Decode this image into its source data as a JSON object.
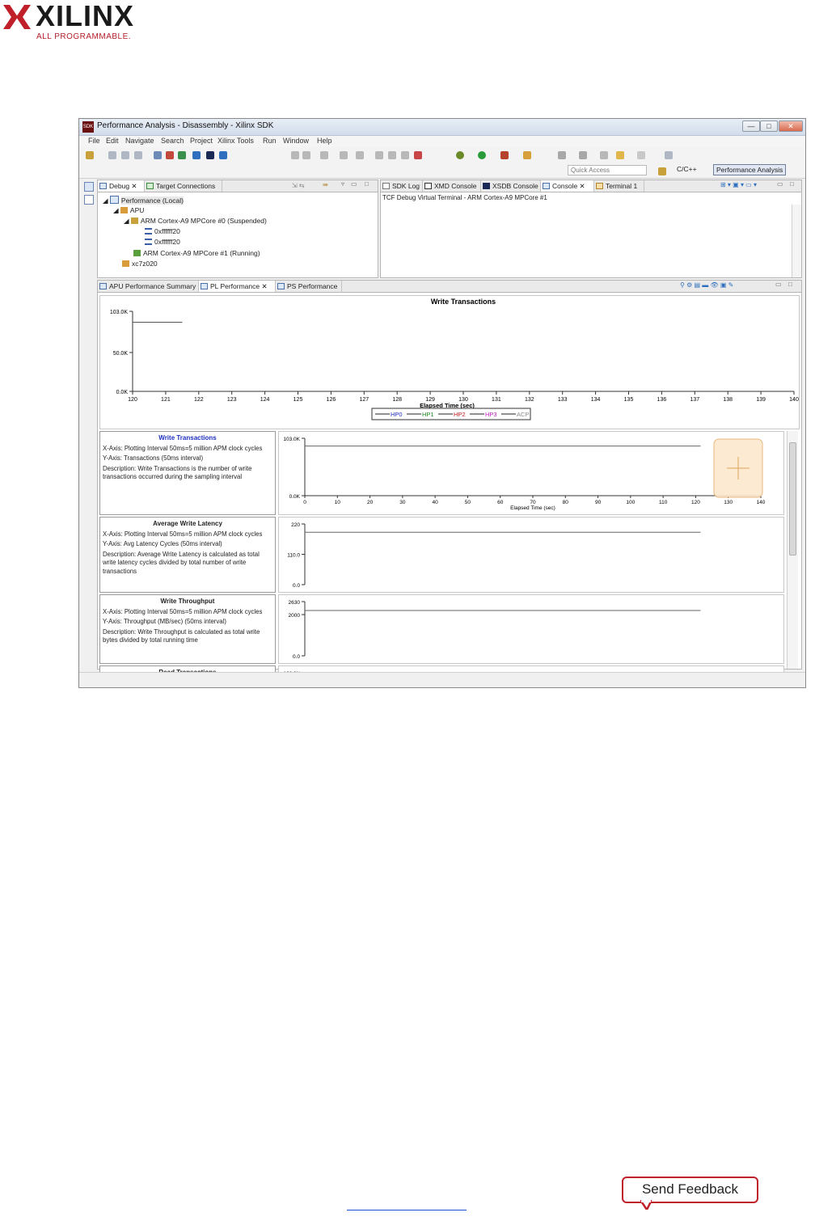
{
  "header": {
    "logo_word": "XILINX",
    "logo_tagline": "ALL PROGRAMMABLE."
  },
  "window": {
    "title": "Performance Analysis - Disassembly - Xilinx SDK",
    "title_icon_text": "SDK",
    "min_label": "—",
    "max_label": "□",
    "close_label": "✕"
  },
  "menu": [
    "File",
    "Edit",
    "Navigate",
    "Search",
    "Project",
    "Xilinx Tools",
    "Run",
    "Window",
    "Help"
  ],
  "toolbar": {
    "quick_access_placeholder": "Quick Access",
    "perspective_cc": "C/C++",
    "perspective_perf": "Performance Analysis"
  },
  "debug_view": {
    "tabs": [
      "Debug",
      "Target Connections"
    ],
    "tree": [
      {
        "label": "Performance (Local)",
        "level": 0
      },
      {
        "label": "APU",
        "level": 1
      },
      {
        "label": "ARM Cortex-A9 MPCore #0 (Suspended)",
        "level": 2
      },
      {
        "label": "0xffffff20",
        "level": 3
      },
      {
        "label": "0xffffff20",
        "level": 3
      },
      {
        "label": "ARM Cortex-A9 MPCore #1 (Running)",
        "level": 2
      },
      {
        "label": "xc7z020",
        "level": 1
      }
    ]
  },
  "console_view": {
    "tabs": [
      "SDK Log",
      "XMD Console",
      "XSDB Console",
      "Console",
      "Terminal 1"
    ],
    "content": "TCF Debug Virtual Terminal - ARM Cortex-A9 MPCore #1"
  },
  "perf_view": {
    "tabs": [
      "APU Performance Summary",
      "PL Performance",
      "PS Performance"
    ]
  },
  "colors": {
    "hp0": "#1f2fbf",
    "hp1": "#1c8a1c",
    "hp2": "#c01c1c",
    "hp3": "#c020c0",
    "acp": "#8a8a8a",
    "feedback_border": "#c0202a"
  },
  "chart_data": [
    {
      "type": "line",
      "title": "Write Transactions",
      "xlabel": "Elapsed Time (sec)",
      "ylabel": "",
      "xlim": [
        120,
        140
      ],
      "ylim": [
        0,
        103000
      ],
      "x_ticks": [
        "120",
        "121",
        "122",
        "123",
        "124",
        "125",
        "126",
        "127",
        "128",
        "129",
        "130",
        "131",
        "132",
        "133",
        "134",
        "135",
        "136",
        "137",
        "138",
        "139",
        "140"
      ],
      "y_ticks": [
        "103.0K",
        "50.0K",
        "0.0K"
      ],
      "legend": [
        "HP0",
        "HP1",
        "HP2",
        "HP3",
        "ACP"
      ],
      "legend_placement": "bottom",
      "series": [
        {
          "name": "HP0",
          "x": [
            120,
            121.5
          ],
          "y": [
            89000,
            89000
          ]
        }
      ]
    },
    {
      "type": "line",
      "title": "Write Transactions",
      "xlabel": "Elapsed Time (sec)",
      "xlim": [
        0,
        140
      ],
      "ylim": [
        0,
        103000
      ],
      "x_ticks": [
        "0",
        "10",
        "20",
        "30",
        "40",
        "50",
        "60",
        "70",
        "80",
        "90",
        "100",
        "110",
        "120",
        "130",
        "140"
      ],
      "y_ticks": [
        "103.0K",
        "0.0K"
      ],
      "series": [
        {
          "name": "HP0",
          "x": [
            0,
            121.5
          ],
          "y": [
            89000,
            89000
          ]
        }
      ]
    },
    {
      "type": "line",
      "title": "Average Write Latency",
      "xlim": [
        0,
        140
      ],
      "ylim": [
        0,
        220
      ],
      "y_ticks": [
        "220",
        "110.0",
        "0.0"
      ],
      "series": [
        {
          "name": "HP0",
          "x": [
            0,
            121.5
          ],
          "y": [
            190,
            190
          ]
        }
      ]
    },
    {
      "type": "line",
      "title": "Write Throughput",
      "xlim": [
        0,
        140
      ],
      "ylim": [
        0,
        2630
      ],
      "y_ticks": [
        "2630",
        "2000",
        "0.0"
      ],
      "series": [
        {
          "name": "HP0",
          "x": [
            0,
            121.5
          ],
          "y": [
            2200,
            2200
          ]
        }
      ]
    }
  ],
  "metric_panels": [
    {
      "title": "Write Transactions",
      "xaxis": "X-Axis: Plotting Interval 50ms=5 million APM clock cycles",
      "yaxis": "Y-Axis: Transactions (50ms interval)",
      "description": "Description: Write Transactions is the number of write transactions occurred during the sampling interval"
    },
    {
      "title": "Average Write Latency",
      "xaxis": "X-Axis: Plotting Interval 50ms=5 million APM clock cycles",
      "yaxis": "Y-Axis: Avg Latency Cycles (50ms interval)",
      "description": "Description: Average Write Latency is calculated as total write latency cycles divided by total number of write transactions"
    },
    {
      "title": "Write Throughput",
      "xaxis": "X-Axis: Plotting Interval 50ms=5 million APM clock cycles",
      "yaxis": "Y-Axis: Throughput (MB/sec) (50ms interval)",
      "description": "Description: Write Throughput is calculated as total write bytes divided by total running time"
    },
    {
      "title": "Read Transactions",
      "xaxis": "",
      "yaxis": "",
      "description": ""
    }
  ],
  "read_chart_top_label": "103.0K",
  "footer": {
    "feedback_label": "Send Feedback"
  }
}
